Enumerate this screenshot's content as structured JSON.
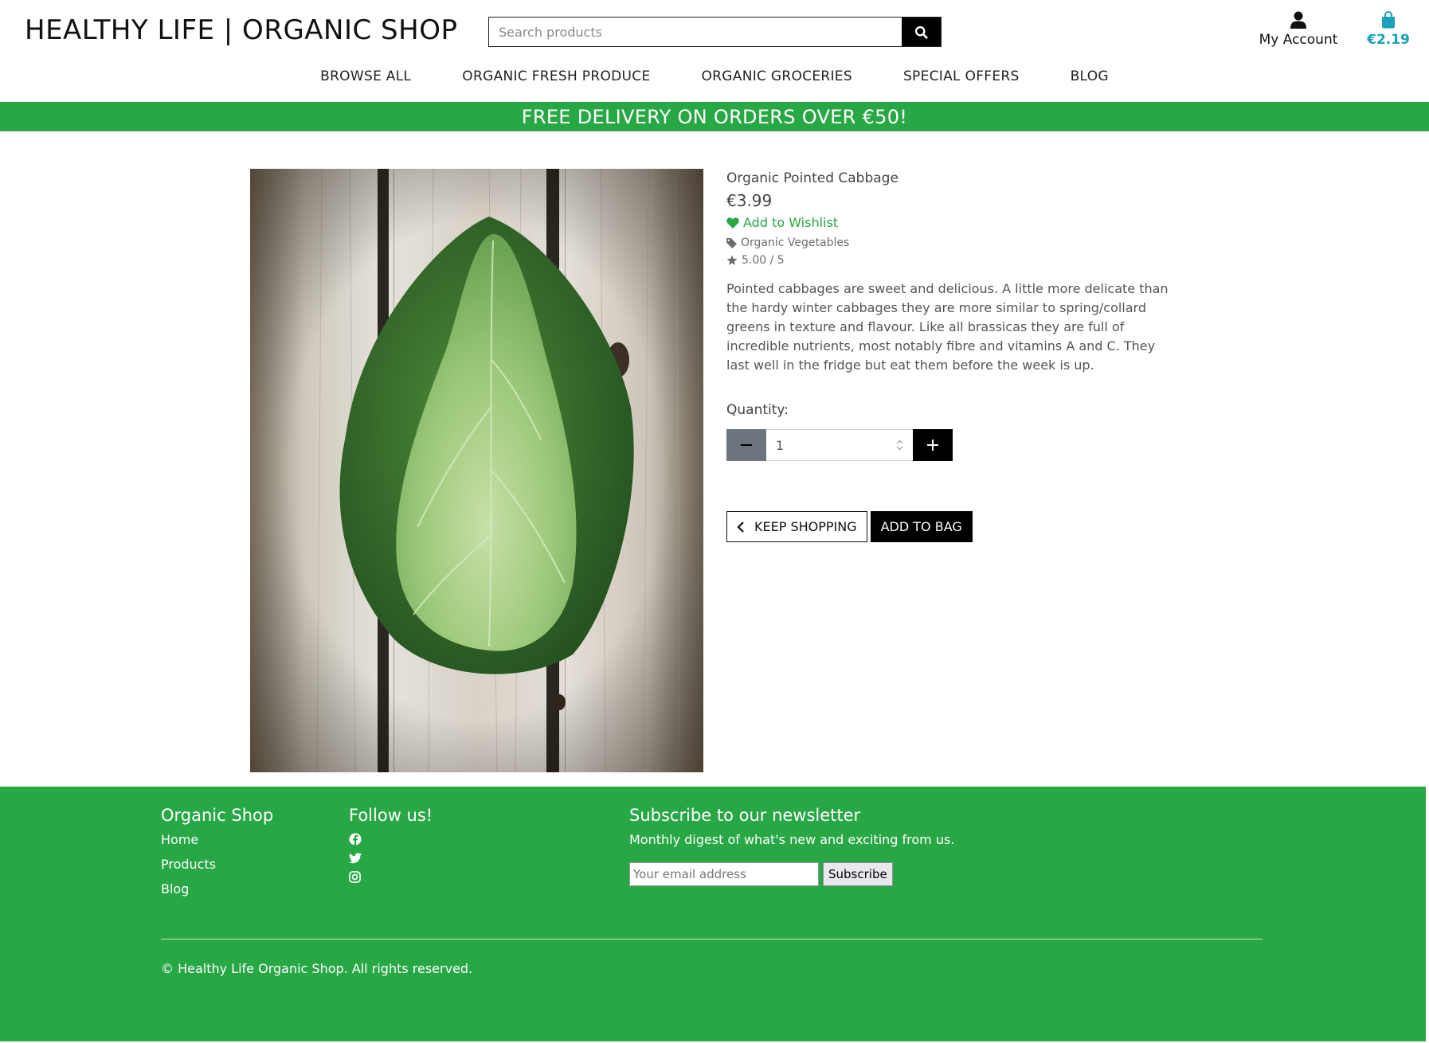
{
  "header": {
    "brand": "HEALTHY LIFE | ORGANIC SHOP",
    "search_placeholder": "Search products",
    "account_label": "My Account",
    "bag_total": "€2.19"
  },
  "nav": {
    "items": [
      "BROWSE ALL",
      "ORGANIC FRESH PRODUCE",
      "ORGANIC GROCERIES",
      "SPECIAL OFFERS",
      "BLOG"
    ]
  },
  "banner": {
    "text": "FREE DELIVERY ON ORDERS OVER €50!"
  },
  "product": {
    "name": "Organic Pointed Cabbage",
    "price": "€3.99",
    "wishlist_label": "Add to Wishlist",
    "category": "Organic Vegetables",
    "rating": "5.00 / 5",
    "description": "Pointed cabbages are sweet and delicious. A little more delicate than the hardy winter cabbages they are more similar to spring/collard greens in texture and flavour. Like all brassicas they are full of incredible nutrients, most notably fibre and vitamins A and C. They last well in the fridge but eat them before the week is up.",
    "quantity_label": "Quantity:",
    "quantity_value": "1",
    "keep_shopping_label": "KEEP SHOPPING",
    "add_to_bag_label": "ADD TO BAG"
  },
  "footer": {
    "shop_title": "Organic Shop",
    "links": [
      "Home",
      "Products",
      "Blog"
    ],
    "follow_title": "Follow us!",
    "social_icons": [
      "facebook-icon",
      "twitter-icon",
      "instagram-icon"
    ],
    "newsletter_title": "Subscribe to our newsletter",
    "newsletter_subtitle": "Monthly digest of what's new and exciting from us.",
    "email_placeholder": "Your email address",
    "subscribe_label": "Subscribe",
    "copyright": "© Healthy Life Organic Shop. All rights reserved."
  },
  "colors": {
    "brand_green": "#28a745",
    "bag_accent": "#1aa0b8",
    "black": "#000000",
    "minus_gray": "#6c757d"
  }
}
